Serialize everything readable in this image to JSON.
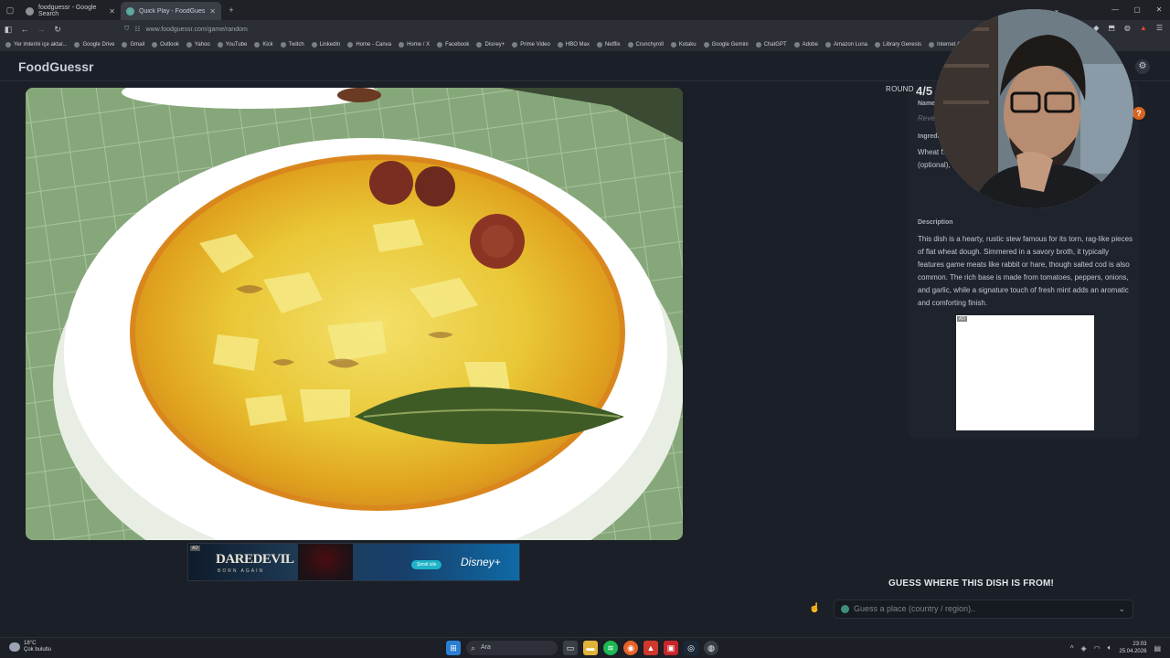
{
  "browser": {
    "tabs": [
      {
        "title": "foodguessr - Google Search",
        "active": false
      },
      {
        "title": "Quick Play - FoodGuessr | Food",
        "active": true
      }
    ],
    "url": "www.foodguessr.com/game/random",
    "bookmarks": [
      "Yer imlerini içe aktar...",
      "Google Drive",
      "Gmail",
      "Outlook",
      "Yahoo",
      "YouTube",
      "Kick",
      "Twitch",
      "LinkedIn",
      "Home - Canva",
      "Home / X",
      "Facebook",
      "Disney+",
      "Prime Video",
      "HBO Max",
      "Netflix",
      "Crunchyroll",
      "Kotaku",
      "Google Gemini",
      "ChatGPT",
      "Adobe",
      "Amazon Luna",
      "Library Genesis",
      "Internet Archive"
    ]
  },
  "app": {
    "logo": "FoodGuessr",
    "round_label": "ROUND",
    "round_value": "4/5",
    "name_label": "Name",
    "name_value": "Reve",
    "ingredients_label": "Ingredients",
    "ingredients_text": "Wheat f... green bell... paprika, rabb... clams (optional)... leaf (optional), black pepper...",
    "ingredients_visible_right": [
      "mint,",
      "),",
      "optional), bay"
    ],
    "description_label": "Description",
    "description_text": "This dish is a hearty, rustic stew famous for its torn, rag-like pieces of flat wheat dough. Simmered in a savory broth, it typically features game meats like rabbit or hare, though salted cod is also common. The rich base is made from tomatoes, peppers, onions, and garlic, while a signature touch of fresh mint adds an aromatic and comforting finish.",
    "ad_tag": "AD",
    "guess_title": "GUESS WHERE THIS DISH IS FROM!",
    "guess_placeholder": "Guess a place (country / region).."
  },
  "banner_ad": {
    "title": "DAREDEVIL",
    "subtitle": "BORN AGAIN",
    "cta": "Şimdi izle",
    "brand": "Disney+"
  },
  "taskbar": {
    "temperature": "18°C",
    "weather": "Çok bulutlu",
    "search": "Ara",
    "time": "23:03",
    "date": "25.04.2026"
  }
}
